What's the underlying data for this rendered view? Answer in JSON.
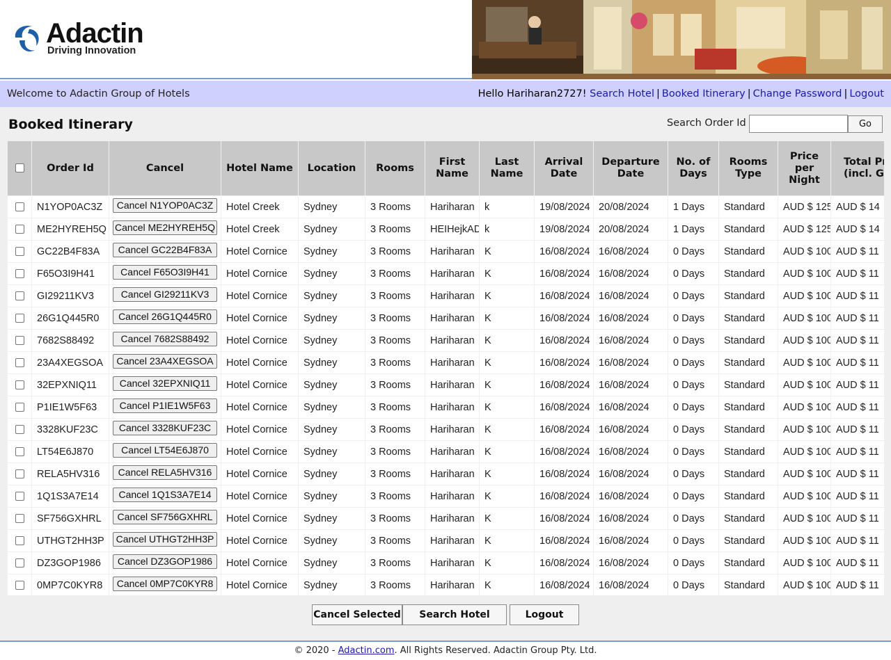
{
  "brand": {
    "name": "Adactin",
    "tagline": "Driving Innovation",
    "accent_color": "#1e5fa8"
  },
  "welcome_bar": {
    "text": "Welcome to Adactin Group of Hotels",
    "greeting": "Hello Hariharan2727!",
    "links": [
      "Search Hotel",
      "Booked Itinerary",
      "Change Password",
      "Logout"
    ],
    "background": "#d0d0ff"
  },
  "page": {
    "title": "Booked Itinerary",
    "search_label": "Search Order Id",
    "search_value": "",
    "go_label": "Go"
  },
  "table": {
    "columns": [
      "",
      "Order Id",
      "Cancel",
      "Hotel Name",
      "Location",
      "Rooms",
      "First Name",
      "Last Name",
      "Arrival Date",
      "Departure Date",
      "No. of Days",
      "Rooms Type",
      "Price per Night",
      "Total Price (incl. GST)"
    ],
    "rows": [
      {
        "order_id": "N1YOP0AC3Z",
        "cancel": "Cancel N1YOP0AC3Z",
        "hotel": "Hotel Creek",
        "location": "Sydney",
        "rooms": "3 Rooms",
        "first": "Hariharan",
        "last": "k",
        "arrival": "19/08/2024",
        "departure": "20/08/2024",
        "days": "1 Days",
        "type": "Standard",
        "price": "AUD $ 125",
        "total": "AUD $ 14"
      },
      {
        "order_id": "ME2HYREH5Q",
        "cancel": "Cancel ME2HYREH5Q",
        "hotel": "Hotel Creek",
        "location": "Sydney",
        "rooms": "3 Rooms",
        "first": "HEIHejkAD",
        "last": "k",
        "arrival": "19/08/2024",
        "departure": "20/08/2024",
        "days": "1 Days",
        "type": "Standard",
        "price": "AUD $ 125",
        "total": "AUD $ 14"
      },
      {
        "order_id": "GC22B4F83A",
        "cancel": "Cancel GC22B4F83A",
        "hotel": "Hotel Cornice",
        "location": "Sydney",
        "rooms": "3 Rooms",
        "first": "Hariharan",
        "last": "K",
        "arrival": "16/08/2024",
        "departure": "16/08/2024",
        "days": "0 Days",
        "type": "Standard",
        "price": "AUD $ 100",
        "total": "AUD $ 11"
      },
      {
        "order_id": "F65O3I9H41",
        "cancel": "Cancel F65O3I9H41",
        "hotel": "Hotel Cornice",
        "location": "Sydney",
        "rooms": "3 Rooms",
        "first": "Hariharan",
        "last": "K",
        "arrival": "16/08/2024",
        "departure": "16/08/2024",
        "days": "0 Days",
        "type": "Standard",
        "price": "AUD $ 100",
        "total": "AUD $ 11"
      },
      {
        "order_id": "GI29211KV3",
        "cancel": "Cancel GI29211KV3",
        "hotel": "Hotel Cornice",
        "location": "Sydney",
        "rooms": "3 Rooms",
        "first": "Hariharan",
        "last": "K",
        "arrival": "16/08/2024",
        "departure": "16/08/2024",
        "days": "0 Days",
        "type": "Standard",
        "price": "AUD $ 100",
        "total": "AUD $ 11"
      },
      {
        "order_id": "26G1Q445R0",
        "cancel": "Cancel 26G1Q445R0",
        "hotel": "Hotel Cornice",
        "location": "Sydney",
        "rooms": "3 Rooms",
        "first": "Hariharan",
        "last": "K",
        "arrival": "16/08/2024",
        "departure": "16/08/2024",
        "days": "0 Days",
        "type": "Standard",
        "price": "AUD $ 100",
        "total": "AUD $ 11"
      },
      {
        "order_id": "7682S88492",
        "cancel": "Cancel 7682S88492",
        "hotel": "Hotel Cornice",
        "location": "Sydney",
        "rooms": "3 Rooms",
        "first": "Hariharan",
        "last": "K",
        "arrival": "16/08/2024",
        "departure": "16/08/2024",
        "days": "0 Days",
        "type": "Standard",
        "price": "AUD $ 100",
        "total": "AUD $ 11"
      },
      {
        "order_id": "23A4XEGSOA",
        "cancel": "Cancel 23A4XEGSOA",
        "hotel": "Hotel Cornice",
        "location": "Sydney",
        "rooms": "3 Rooms",
        "first": "Hariharan",
        "last": "K",
        "arrival": "16/08/2024",
        "departure": "16/08/2024",
        "days": "0 Days",
        "type": "Standard",
        "price": "AUD $ 100",
        "total": "AUD $ 11"
      },
      {
        "order_id": "32EPXNIQ11",
        "cancel": "Cancel 32EPXNIQ11",
        "hotel": "Hotel Cornice",
        "location": "Sydney",
        "rooms": "3 Rooms",
        "first": "Hariharan",
        "last": "K",
        "arrival": "16/08/2024",
        "departure": "16/08/2024",
        "days": "0 Days",
        "type": "Standard",
        "price": "AUD $ 100",
        "total": "AUD $ 11"
      },
      {
        "order_id": "P1IE1W5F63",
        "cancel": "Cancel P1IE1W5F63",
        "hotel": "Hotel Cornice",
        "location": "Sydney",
        "rooms": "3 Rooms",
        "first": "Hariharan",
        "last": "K",
        "arrival": "16/08/2024",
        "departure": "16/08/2024",
        "days": "0 Days",
        "type": "Standard",
        "price": "AUD $ 100",
        "total": "AUD $ 11"
      },
      {
        "order_id": "3328KUF23C",
        "cancel": "Cancel 3328KUF23C",
        "hotel": "Hotel Cornice",
        "location": "Sydney",
        "rooms": "3 Rooms",
        "first": "Hariharan",
        "last": "K",
        "arrival": "16/08/2024",
        "departure": "16/08/2024",
        "days": "0 Days",
        "type": "Standard",
        "price": "AUD $ 100",
        "total": "AUD $ 11"
      },
      {
        "order_id": "LT54E6J870",
        "cancel": "Cancel LT54E6J870",
        "hotel": "Hotel Cornice",
        "location": "Sydney",
        "rooms": "3 Rooms",
        "first": "Hariharan",
        "last": "K",
        "arrival": "16/08/2024",
        "departure": "16/08/2024",
        "days": "0 Days",
        "type": "Standard",
        "price": "AUD $ 100",
        "total": "AUD $ 11"
      },
      {
        "order_id": "RELA5HV316",
        "cancel": "Cancel RELA5HV316",
        "hotel": "Hotel Cornice",
        "location": "Sydney",
        "rooms": "3 Rooms",
        "first": "Hariharan",
        "last": "K",
        "arrival": "16/08/2024",
        "departure": "16/08/2024",
        "days": "0 Days",
        "type": "Standard",
        "price": "AUD $ 100",
        "total": "AUD $ 11"
      },
      {
        "order_id": "1Q1S3A7E14",
        "cancel": "Cancel 1Q1S3A7E14",
        "hotel": "Hotel Cornice",
        "location": "Sydney",
        "rooms": "3 Rooms",
        "first": "Hariharan",
        "last": "K",
        "arrival": "16/08/2024",
        "departure": "16/08/2024",
        "days": "0 Days",
        "type": "Standard",
        "price": "AUD $ 100",
        "total": "AUD $ 11"
      },
      {
        "order_id": "SF756GXHRL",
        "cancel": "Cancel SF756GXHRL",
        "hotel": "Hotel Cornice",
        "location": "Sydney",
        "rooms": "3 Rooms",
        "first": "Hariharan",
        "last": "K",
        "arrival": "16/08/2024",
        "departure": "16/08/2024",
        "days": "0 Days",
        "type": "Standard",
        "price": "AUD $ 100",
        "total": "AUD $ 11"
      },
      {
        "order_id": "UTHGT2HH3P",
        "cancel": "Cancel UTHGT2HH3P",
        "hotel": "Hotel Cornice",
        "location": "Sydney",
        "rooms": "3 Rooms",
        "first": "Hariharan",
        "last": "K",
        "arrival": "16/08/2024",
        "departure": "16/08/2024",
        "days": "0 Days",
        "type": "Standard",
        "price": "AUD $ 100",
        "total": "AUD $ 11"
      },
      {
        "order_id": "DZ3GOP1986",
        "cancel": "Cancel DZ3GOP1986",
        "hotel": "Hotel Cornice",
        "location": "Sydney",
        "rooms": "3 Rooms",
        "first": "Hariharan",
        "last": "K",
        "arrival": "16/08/2024",
        "departure": "16/08/2024",
        "days": "0 Days",
        "type": "Standard",
        "price": "AUD $ 100",
        "total": "AUD $ 11"
      },
      {
        "order_id": "0MP7C0KYR8",
        "cancel": "Cancel 0MP7C0KYR8",
        "hotel": "Hotel Cornice",
        "location": "Sydney",
        "rooms": "3 Rooms",
        "first": "Hariharan",
        "last": "K",
        "arrival": "16/08/2024",
        "departure": "16/08/2024",
        "days": "0 Days",
        "type": "Standard",
        "price": "AUD $ 100",
        "total": "AUD $ 11"
      }
    ]
  },
  "actions": {
    "cancel_selected": "Cancel Selected",
    "search_hotel": "Search Hotel",
    "logout": "Logout"
  },
  "footer": {
    "prefix": "© 2020 - ",
    "link": "Adactin.com",
    "suffix": ". All Rights Reserved. Adactin Group Pty. Ltd."
  }
}
